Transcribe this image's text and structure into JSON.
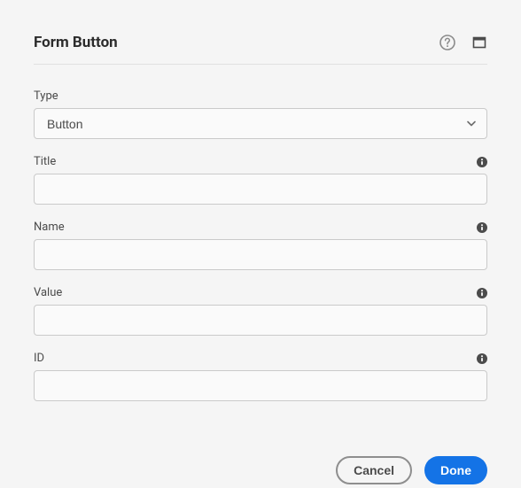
{
  "dialog": {
    "title": "Form Button"
  },
  "fields": {
    "type": {
      "label": "Type",
      "selected": "Button",
      "options": [
        "Button"
      ]
    },
    "title": {
      "label": "Title",
      "value": ""
    },
    "name": {
      "label": "Name",
      "value": ""
    },
    "value": {
      "label": "Value",
      "value": ""
    },
    "id": {
      "label": "ID",
      "value": ""
    }
  },
  "footer": {
    "cancel": "Cancel",
    "done": "Done"
  },
  "icons": {
    "help": "help-icon",
    "fullscreen": "fullscreen-icon",
    "info": "info-icon",
    "chevron": "chevron-down-icon"
  }
}
